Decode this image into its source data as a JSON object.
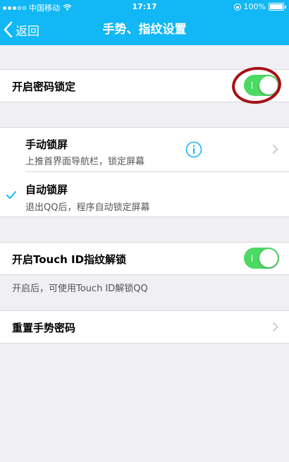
{
  "status_bar": {
    "carrier": "中国移动",
    "time": "17:17",
    "battery": "100%",
    "icons": [
      "signal-dots-icon",
      "wifi-icon",
      "orientation-lock-icon",
      "battery-icon"
    ]
  },
  "nav": {
    "back_label": "返回",
    "title": "手势、指纹设置"
  },
  "passcode": {
    "label": "开启密码锁定",
    "toggle_on": true
  },
  "lock_modes": [
    {
      "title": "手动锁屏",
      "subtitle": "上推首界面导航栏，锁定屏幕",
      "selected": false,
      "icons": [
        "info-icon",
        "chevron-right-icon"
      ]
    },
    {
      "title": "自动锁屏",
      "subtitle": "退出QQ后，程序自动锁定屏幕",
      "selected": true,
      "icons": [
        "checkmark-icon"
      ]
    }
  ],
  "touch_id": {
    "label": "开启Touch ID指纹解锁",
    "toggle_on": true,
    "note": "开启后，可使用Touch ID解锁QQ"
  },
  "reset": {
    "label": "重置手势密码"
  },
  "colors": {
    "accent": "#12b7f5",
    "toggle_on": "#4cd964",
    "check": "#12b7f5",
    "highlight": "#a60f16"
  }
}
